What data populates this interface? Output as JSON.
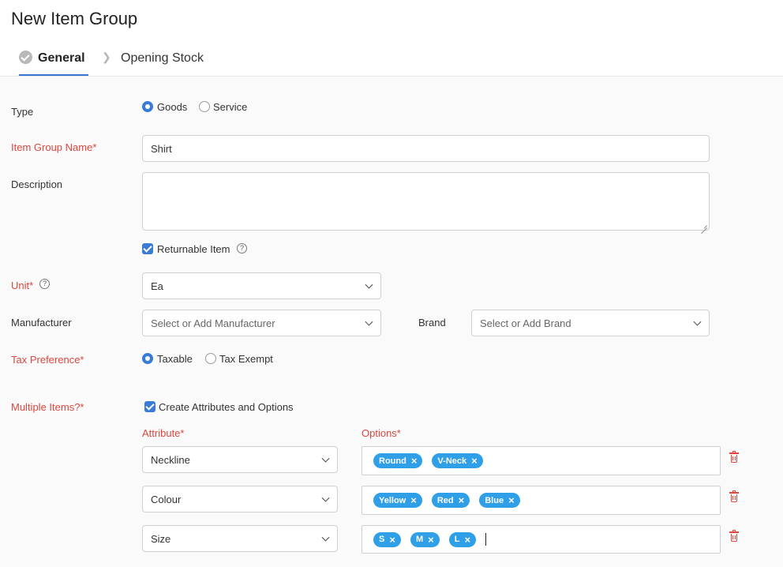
{
  "page": {
    "title": "New Item Group"
  },
  "tabs": {
    "general": "General",
    "opening_stock": "Opening Stock"
  },
  "form": {
    "type": {
      "label": "Type",
      "options": [
        "Goods",
        "Service"
      ],
      "selected": "Goods"
    },
    "item_group_name": {
      "label": "Item Group Name*",
      "value": "Shirt"
    },
    "description": {
      "label": "Description",
      "value": ""
    },
    "returnable": {
      "label": "Returnable Item",
      "checked": true
    },
    "unit": {
      "label": "Unit*",
      "value": "Ea"
    },
    "manufacturer": {
      "label": "Manufacturer",
      "placeholder": "Select or Add Manufacturer"
    },
    "brand": {
      "label": "Brand",
      "placeholder": "Select or Add Brand"
    },
    "tax_preference": {
      "label": "Tax Preference*",
      "options": [
        "Taxable",
        "Tax Exempt"
      ],
      "selected": "Taxable"
    },
    "multiple_items": {
      "label": "Multiple Items?*",
      "checkbox_label": "Create Attributes and Options",
      "checked": true
    }
  },
  "attributes": {
    "attribute_header": "Attribute*",
    "options_header": "Options*",
    "rows": [
      {
        "attribute": "Neckline",
        "options": [
          "Round",
          "V-Neck"
        ]
      },
      {
        "attribute": "Colour",
        "options": [
          "Yellow",
          "Red",
          "Blue"
        ]
      },
      {
        "attribute": "Size",
        "options": [
          "S",
          "M",
          "L"
        ]
      }
    ]
  },
  "icons": {
    "remove_tag": "×",
    "help": "?",
    "delete": "trash-icon"
  },
  "colors": {
    "accent": "#3a7bd5",
    "required": "#d9473f",
    "tag": "#2f9fe8",
    "delete": "#e0453d"
  }
}
